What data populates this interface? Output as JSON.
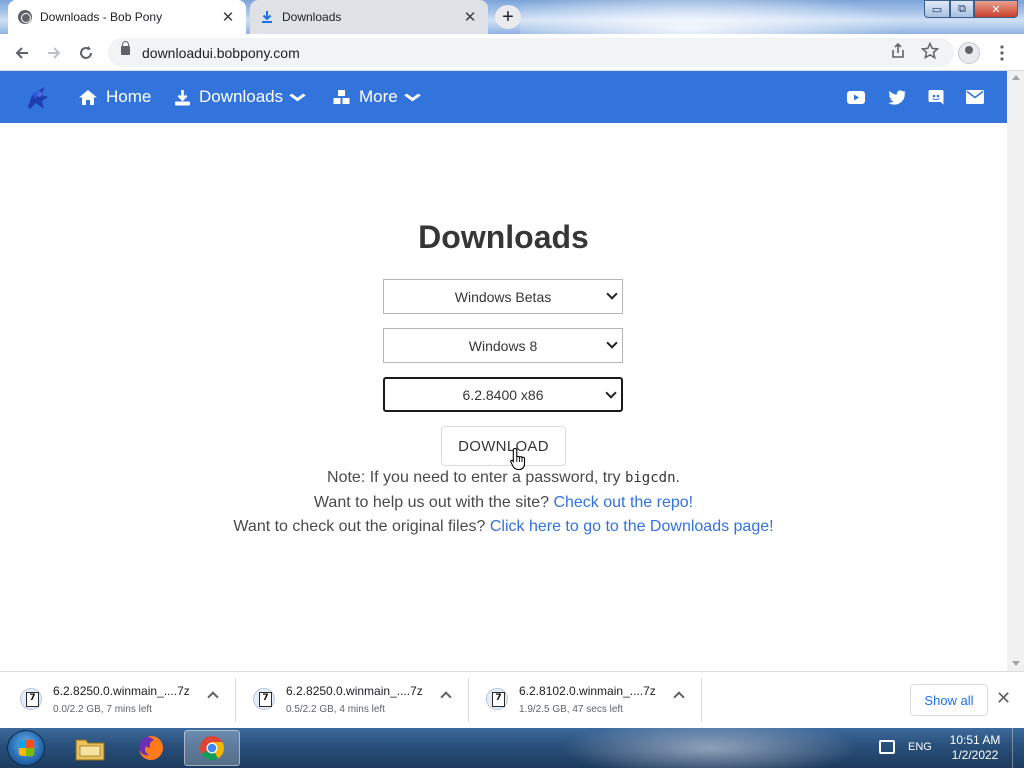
{
  "browser": {
    "tabs": [
      {
        "title": "Downloads - Bob Pony",
        "active": true,
        "icon": "globe-icon"
      },
      {
        "title": "Downloads",
        "active": false,
        "icon": "download-icon"
      }
    ],
    "new_tab_label": "+",
    "url": "downloadui.bobpony.com",
    "window_controls": {
      "minimize": "▭",
      "maximize": "⧉",
      "close": "✕"
    }
  },
  "site": {
    "nav": {
      "home": "Home",
      "downloads": "Downloads",
      "more": "More"
    },
    "social": [
      "youtube-icon",
      "twitter-icon",
      "discord-icon",
      "mail-icon"
    ],
    "colors": {
      "brand": "#3273dc"
    }
  },
  "page": {
    "heading": "Downloads",
    "select_category": "Windows Betas",
    "select_os": "Windows 8",
    "select_build": "6.2.8400 x86",
    "download_button": "DOWNLOAD",
    "note_prefix": "Note: If you need to enter a password, try ",
    "note_password": "bigcdn",
    "note_suffix": ".",
    "help_prefix": "Want to help us out with the site? ",
    "help_link": "Check out the repo!",
    "orig_prefix": "Want to check out the original files? ",
    "orig_link": "Click here to go to the Downloads page!"
  },
  "download_shelf": {
    "items": [
      {
        "name": "6.2.8250.0.winmain_....7z",
        "status": "0.0/2.2 GB, 7 mins left"
      },
      {
        "name": "6.2.8250.0.winmain_....7z",
        "status": "0.5/2.2 GB, 4 mins left"
      },
      {
        "name": "6.2.8102.0.winmain_....7z",
        "status": "1.9/2.5 GB, 47 secs left"
      }
    ],
    "show_all": "Show all",
    "close": "✕"
  },
  "taskbar": {
    "apps": [
      "file-explorer-icon",
      "firefox-icon",
      "chrome-icon"
    ],
    "language": "ENG",
    "time": "10:51 AM",
    "date": "1/2/2022"
  }
}
